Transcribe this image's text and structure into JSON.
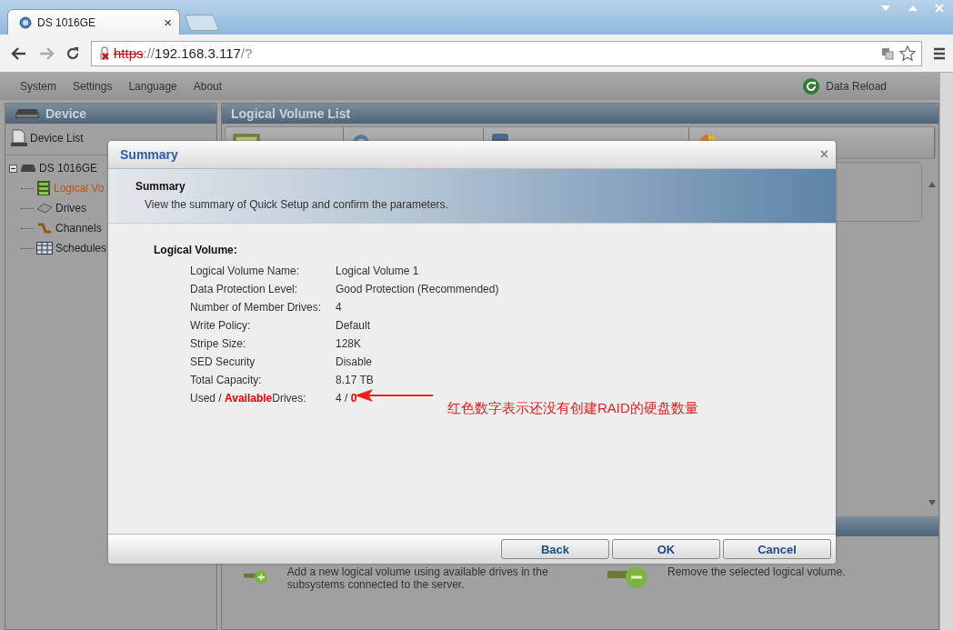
{
  "browser": {
    "tab": {
      "title": "DS 1016GE",
      "close": "×"
    },
    "url": {
      "scheme": "https",
      "separator": "://",
      "host": "192.168.3.117",
      "path": "/?"
    }
  },
  "menu": [
    "System",
    "Settings",
    "Language",
    "About"
  ],
  "data_reload": "Data Reload",
  "device_panel": {
    "title": "Device",
    "device_list": "Device List",
    "tree": [
      {
        "label": "DS 1016GE",
        "kind": "device",
        "expanded": true,
        "selected": false,
        "children": [
          {
            "label": "Logical Vo",
            "kind": "volume",
            "selected": true
          },
          {
            "label": "Drives",
            "kind": "drive",
            "selected": false
          },
          {
            "label": "Channels",
            "kind": "channel",
            "selected": false
          },
          {
            "label": "Schedules",
            "kind": "schedule",
            "selected": false
          }
        ]
      }
    ]
  },
  "list_panel": {
    "title": "Logical Volume List",
    "columns": [
      {
        "kind": "name"
      },
      {
        "kind": "status"
      },
      {
        "kind": "amount"
      },
      {
        "kind": "capacity"
      }
    ],
    "actions": [
      {
        "kind": "add",
        "text": "Add a new logical volume using available drives in the subsystems connected to the server."
      },
      {
        "kind": "remove",
        "text": "Remove the selected logical volume."
      }
    ]
  },
  "dialog": {
    "title": "Summary",
    "close": "×",
    "heading": "Summary",
    "description": "View the summary of Quick Setup and confirm the parameters.",
    "section": "Logical Volume:",
    "rows": [
      {
        "label": "Logical Volume Name:",
        "value": "Logical Volume 1"
      },
      {
        "label": "Data Protection Level:",
        "value": "Good Protection (Recommended)"
      },
      {
        "label": "Number of Member Drives:",
        "value": "4"
      },
      {
        "label": "Write Policy:",
        "value": "Default"
      },
      {
        "label": "Stripe Size:",
        "value": "128K"
      },
      {
        "label": "SED Security",
        "value": "Disable"
      },
      {
        "label": "Total Capacity:",
        "value": "8.17 TB"
      },
      {
        "label": "Used / **Available**Drives:",
        "value": "4 / **0**"
      }
    ],
    "buttons": [
      "Back",
      "OK",
      "Cancel"
    ]
  },
  "annotation": {
    "text": "红色数字表示还没有创建RAID的硬盘数量"
  }
}
